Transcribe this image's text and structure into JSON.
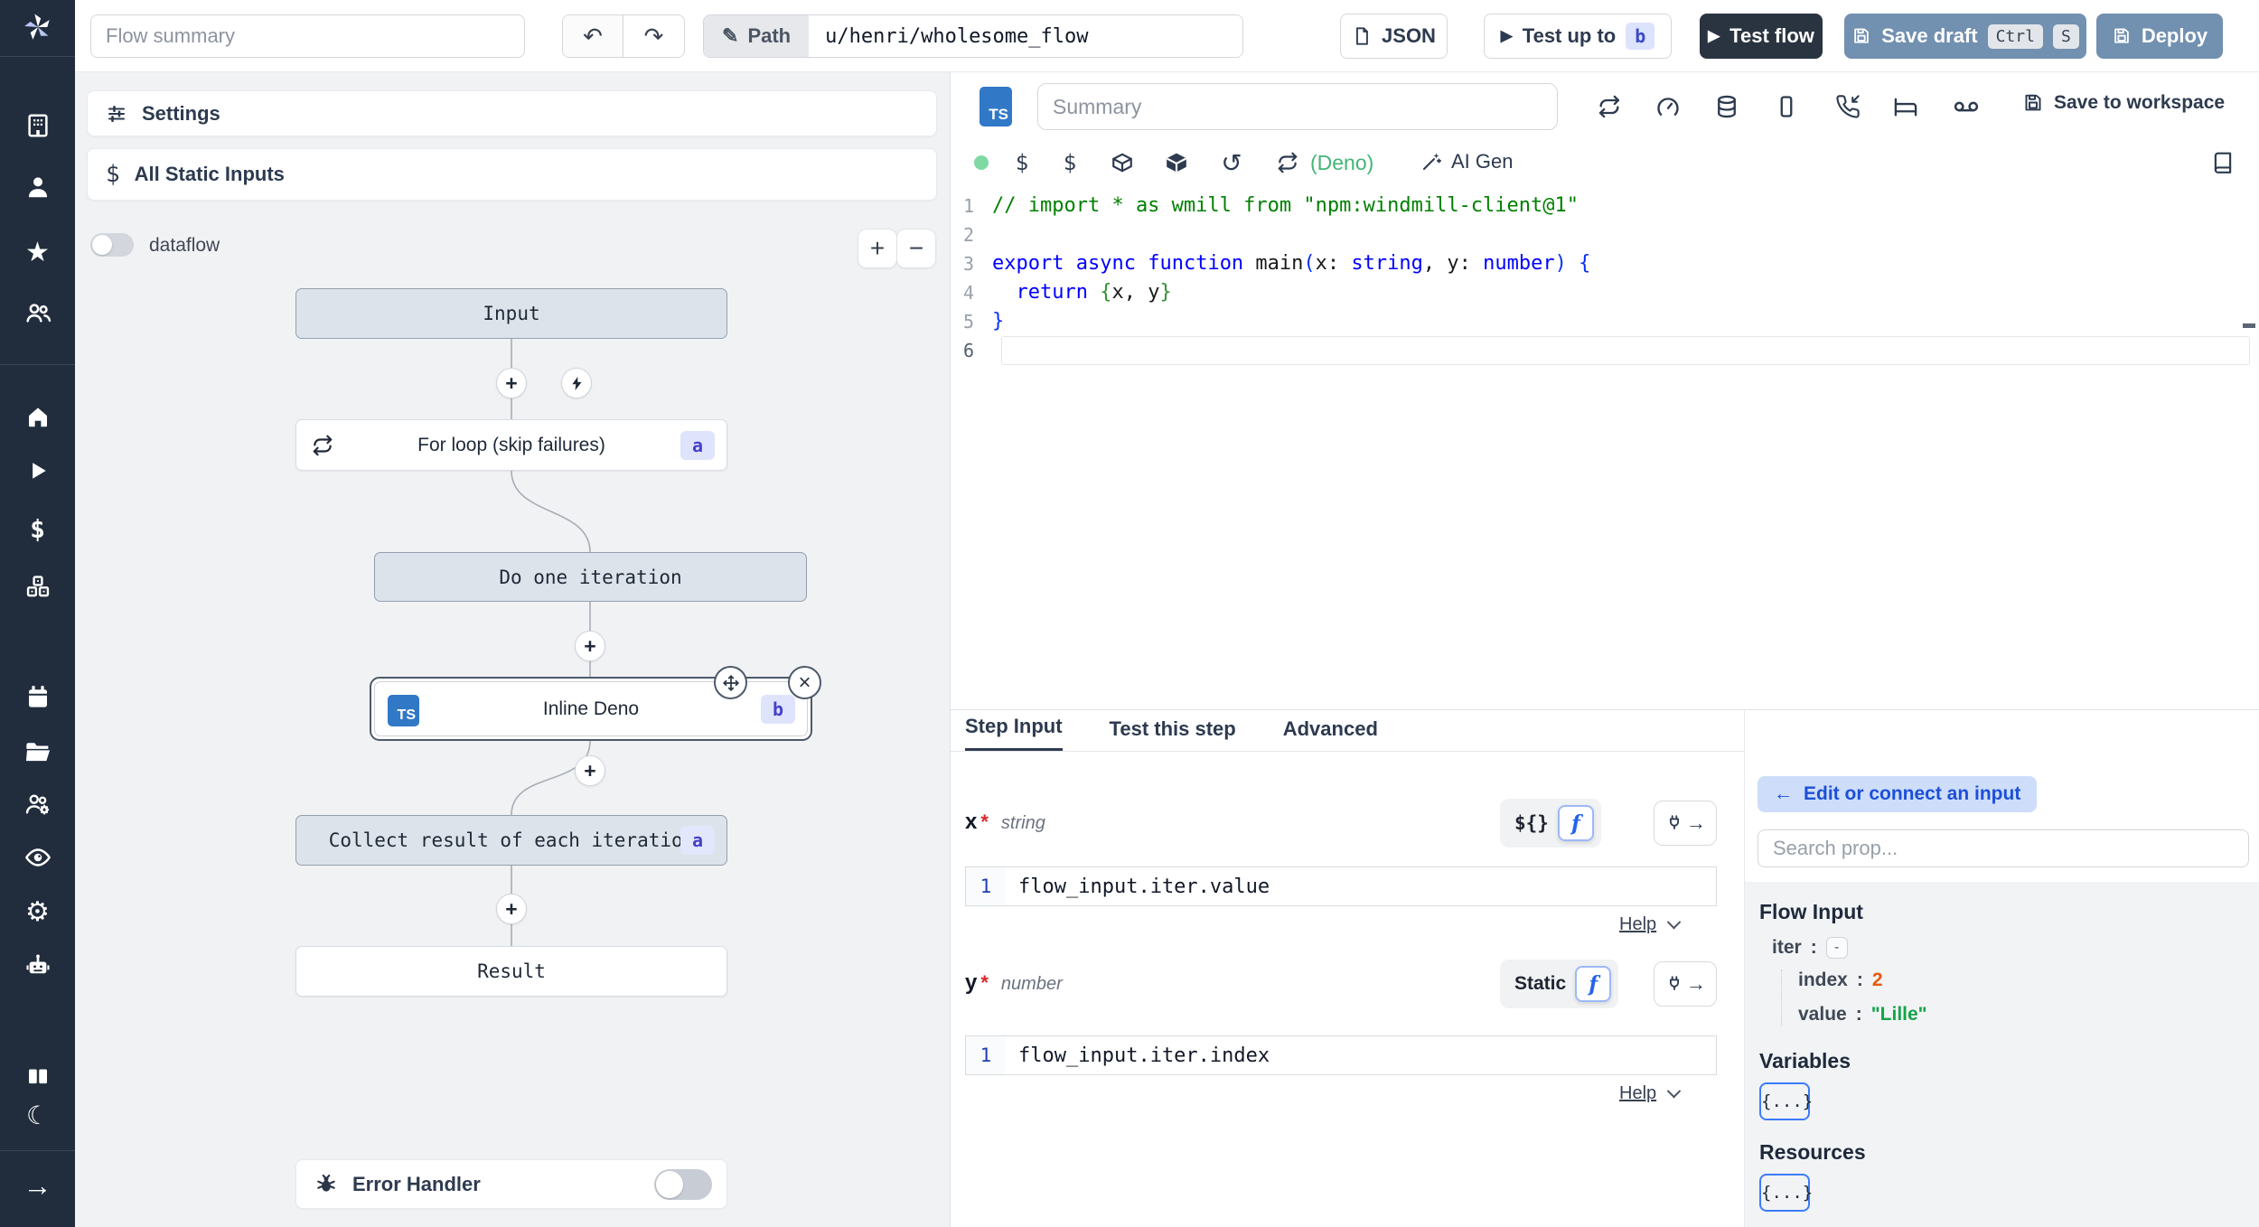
{
  "sidebar": {
    "icons": [
      "windmill-logo",
      "building",
      "user",
      "star",
      "user-group",
      "home",
      "play",
      "dollar",
      "cubes",
      "calendar",
      "folder",
      "group-settings",
      "eye",
      "gear",
      "robot",
      "books",
      "moon",
      "expand-arrow"
    ]
  },
  "topbar": {
    "flow_summary_placeholder": "Flow summary",
    "path_label": "Path",
    "path_value": "u/henri/wholesome_flow",
    "json_button": "JSON",
    "test_up_to": "Test up to",
    "test_up_to_badge": "b",
    "test_flow": "Test flow",
    "save_draft": "Save draft",
    "save_draft_key1": "Ctrl",
    "save_draft_key2": "S",
    "deploy": "Deploy"
  },
  "left": {
    "settings": "Settings",
    "all_static_inputs": "All Static Inputs",
    "dataflow": "dataflow",
    "error_handler": "Error Handler"
  },
  "graph": {
    "input": "Input",
    "forloop": "For loop (skip failures)",
    "forloop_badge": "a",
    "iteration": "Do one iteration",
    "inline": "Inline Deno",
    "inline_badge": "b",
    "inline_lang": "TS",
    "collect": "Collect result of each iteration",
    "collect_badge": "a",
    "result": "Result"
  },
  "editor": {
    "lang_badge": "TS",
    "summary_placeholder": "Summary",
    "save_to_workspace": "Save to workspace",
    "runtime": "(Deno)",
    "ai_gen": "AI Gen",
    "code_lines": [
      {
        "n": "1",
        "tokens": [
          {
            "t": "// import * as wmill from \"npm:windmill-client@1\"",
            "c": "cm"
          }
        ]
      },
      {
        "n": "2",
        "tokens": []
      },
      {
        "n": "3",
        "tokens": [
          {
            "t": "export",
            "c": "kw"
          },
          {
            "t": " ",
            "c": "tx"
          },
          {
            "t": "async",
            "c": "kw"
          },
          {
            "t": " ",
            "c": "tx"
          },
          {
            "t": "function",
            "c": "kw"
          },
          {
            "t": " main",
            "c": "tx"
          },
          {
            "t": "(",
            "c": "b1"
          },
          {
            "t": "x",
            "c": "tx"
          },
          {
            "t": ": ",
            "c": "tx"
          },
          {
            "t": "string",
            "c": "kw"
          },
          {
            "t": ", y",
            "c": "tx"
          },
          {
            "t": ": ",
            "c": "tx"
          },
          {
            "t": "number",
            "c": "kw"
          },
          {
            "t": ")",
            "c": "b1"
          },
          {
            "t": " ",
            "c": "tx"
          },
          {
            "t": "{",
            "c": "b1"
          }
        ]
      },
      {
        "n": "4",
        "tokens": [
          {
            "t": "  ",
            "c": "tx"
          },
          {
            "t": "return",
            "c": "kw"
          },
          {
            "t": " ",
            "c": "tx"
          },
          {
            "t": "{",
            "c": "b2"
          },
          {
            "t": "x, y",
            "c": "tx"
          },
          {
            "t": "}",
            "c": "b2"
          }
        ]
      },
      {
        "n": "5",
        "tokens": [
          {
            "t": "}",
            "c": "b1"
          }
        ]
      },
      {
        "n": "6",
        "tokens": []
      }
    ]
  },
  "step_panel": {
    "tabs": {
      "t0": "Step Input",
      "t1": "Test this step",
      "t2": "Advanced"
    },
    "fields": [
      {
        "name": "x",
        "req": "*",
        "type": "string",
        "mode": "${}",
        "line": "1",
        "expr": "flow_input.iter.value",
        "help": "Help"
      },
      {
        "name": "y",
        "req": "*",
        "type": "number",
        "mode": "Static",
        "line": "1",
        "expr": "flow_input.iter.index",
        "help": "Help"
      }
    ]
  },
  "prop_picker": {
    "edit_connect": "Edit or connect an input",
    "search_placeholder": "Search prop...",
    "flow_input_title": "Flow Input",
    "tree": {
      "iter_key": "iter",
      "sep": ":",
      "collapse": "-",
      "index_key": "index",
      "index_value": "2",
      "value_key": "value",
      "value_value": "\"Lille\""
    },
    "variables_title": "Variables",
    "resources_title": "Resources",
    "object_button": "{...}"
  },
  "glyphs": {
    "undo": "↶",
    "redo": "↷",
    "pencil": "✎",
    "star": "★",
    "gear": "⚙",
    "moon": "☾",
    "history": "↺",
    "dollar": "$",
    "play": "▶",
    "plus": "+",
    "minus": "−",
    "close": "×",
    "arrow_right": "→",
    "arrow_left": "←"
  }
}
